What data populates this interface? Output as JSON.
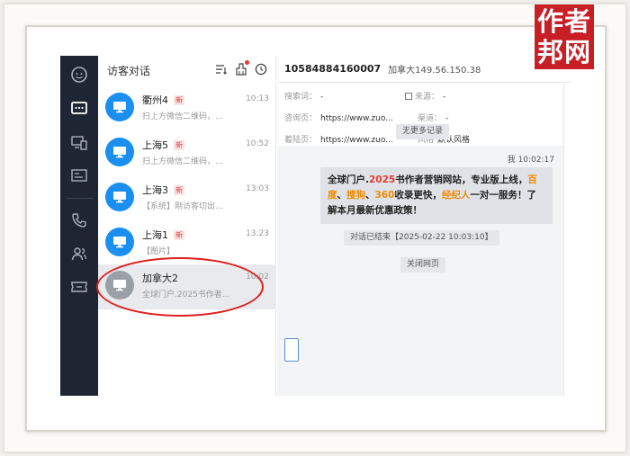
{
  "brand": {
    "line1": "作者",
    "line2": "邦网"
  },
  "list": {
    "title": "访客对话",
    "items": [
      {
        "name": "衢州4",
        "badge": "新",
        "time": "10:13",
        "preview": "扫上方微信二维码，..."
      },
      {
        "name": "上海5",
        "badge": "新",
        "time": "10:52",
        "preview": "扫上方微信二维码，..."
      },
      {
        "name": "上海3",
        "badge": "新",
        "time": "13:03",
        "preview": "【系统】刚访客切出..."
      },
      {
        "name": "上海1",
        "badge": "新",
        "time": "13:23",
        "preview": "【图片】"
      },
      {
        "name": "加拿大2",
        "badge": "",
        "time": "10:02",
        "preview": "全球门户.2025书作者..."
      }
    ]
  },
  "chat": {
    "visitor_id": "10584884160007",
    "visitor_ip": "加拿大149.56.150.38",
    "info": {
      "search_k": "搜索词：",
      "search_v": "-",
      "source_k": "来源：",
      "source_v": "-",
      "consult_k": "咨询页：",
      "consult_v": "https://www.zuo...",
      "channel_k": "渠道：",
      "channel_v": "-",
      "landing_k": "着陆页：",
      "landing_v": "https://www.zuo...",
      "style_k": "风格",
      "style_v": "默认风格"
    },
    "no_more": "无更多记录",
    "msg_meta": "我  10:02:17",
    "msg": {
      "p1": "全球门户.",
      "p2": "2025",
      "p3": "书作者营销网站，专业版上线，",
      "p4": "百度",
      "p5": "、",
      "p6": "搜狗",
      "p7": "、",
      "p8": "360",
      "p9": "收录更快，",
      "p10": "经纪人",
      "p11": "一对一服务！了解本月最新优惠政策！"
    },
    "ended": "对话已结束【2025-02-22 10:03:10】",
    "closed": "关闭网页"
  }
}
